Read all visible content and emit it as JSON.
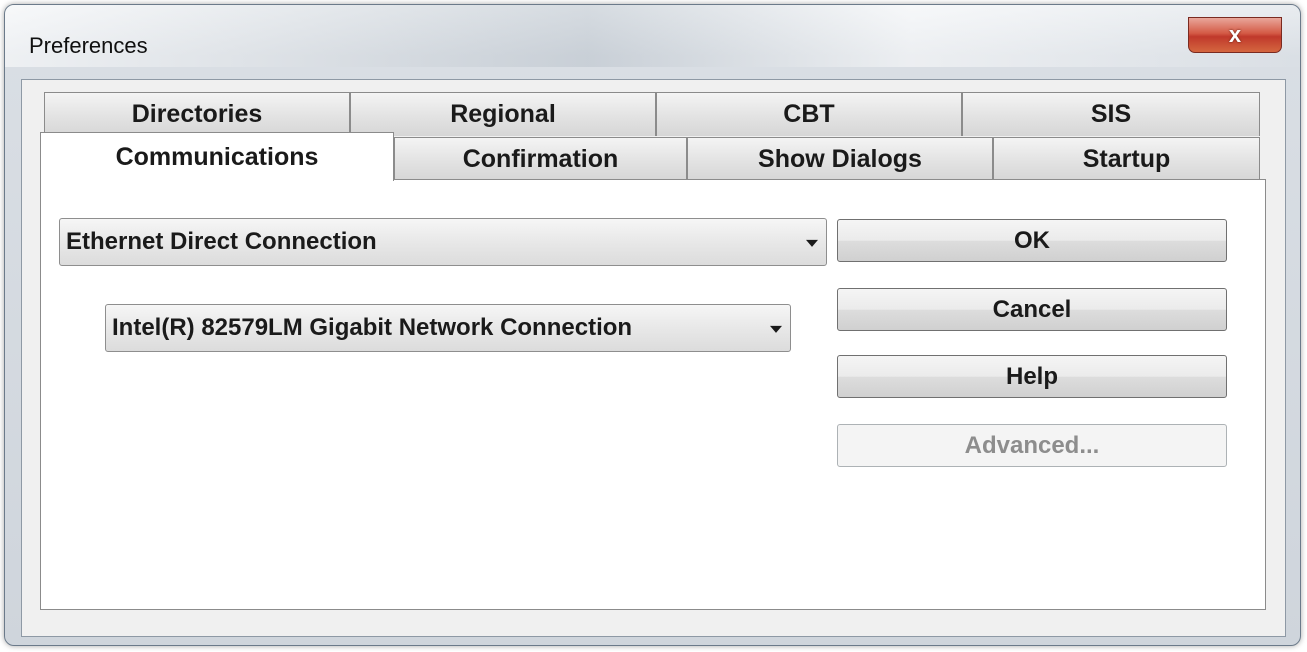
{
  "window": {
    "title": "Preferences",
    "close_label": "x"
  },
  "tabs": {
    "row1": [
      "Directories",
      "Regional",
      "CBT",
      "SIS"
    ],
    "row2": [
      "Communications",
      "Confirmation",
      "Show Dialogs",
      "Startup"
    ],
    "active": "Communications"
  },
  "communications": {
    "connection_type": "Ethernet Direct Connection",
    "network_adapter": "Intel(R) 82579LM Gigabit Network Connection"
  },
  "buttons": {
    "ok": "OK",
    "cancel": "Cancel",
    "help": "Help",
    "advanced": "Advanced..."
  }
}
